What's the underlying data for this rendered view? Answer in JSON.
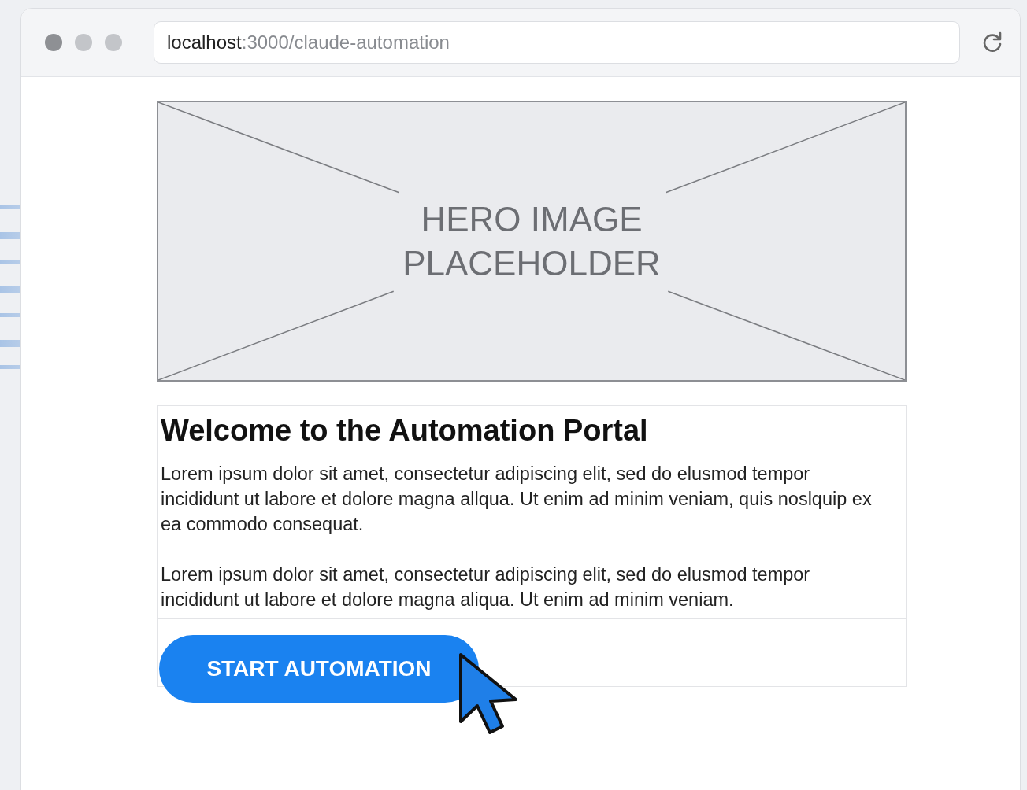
{
  "browser": {
    "address": {
      "host": "localhost",
      "path": ":3000/claude-automation"
    }
  },
  "hero": {
    "label": "HERO IMAGE PLACEHOLDER"
  },
  "content": {
    "heading": "Welcome to the Automation Portal",
    "paragraphs": [
      "Lorem ipsum dolor sit amet, consectetur adipiscing elit, sed do elusmod tempor incididunt ut labore et dolore magna allqua. Ut enim ad minim veniam, quis noslquip ex ea commodo consequat.",
      "Lorem ipsum dolor sit amet, consectetur adipiscing elit, sed do elusmod tempor incididunt ut labore et dolore magna aliqua. Ut enim ad minim veniam."
    ],
    "button": "START AUTOMATION"
  }
}
